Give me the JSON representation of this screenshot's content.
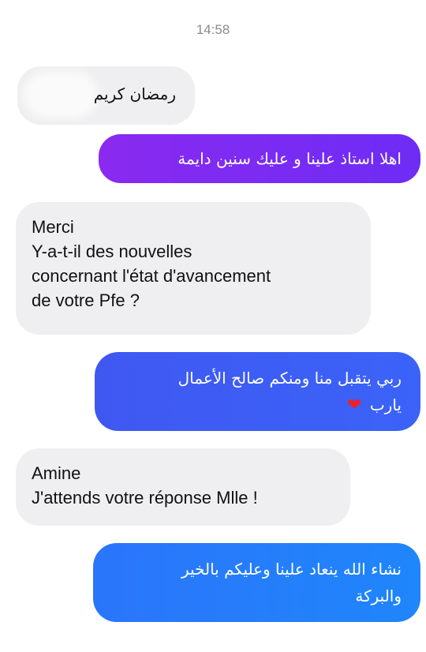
{
  "chat": {
    "timestamp": "14:58",
    "messages": [
      {
        "direction": "received",
        "text": "رمضان كريم"
      },
      {
        "direction": "sent",
        "text": "اهلا استاذ علينا و عليك سنين دايمة",
        "color": "#7b2bf2"
      },
      {
        "direction": "received",
        "lines": [
          "Merci",
          "Y-a-t-il des nouvelles",
          "concernant l'état d'avancement",
          "de votre Pfe ?"
        ]
      },
      {
        "direction": "sent",
        "lines": [
          "ربي يتقبل منا ومنكم صالح الأعمال",
          "يارب"
        ],
        "emoji": "red-heart",
        "color": "#3d5df5"
      },
      {
        "direction": "received",
        "lines": [
          "Amine",
          "J'attends votre réponse Mlle !"
        ]
      },
      {
        "direction": "sent",
        "lines": [
          "نشاء الله ينعاد علينا وعليكم بالخير",
          "والبركة"
        ],
        "color": "#247dfb"
      }
    ]
  }
}
